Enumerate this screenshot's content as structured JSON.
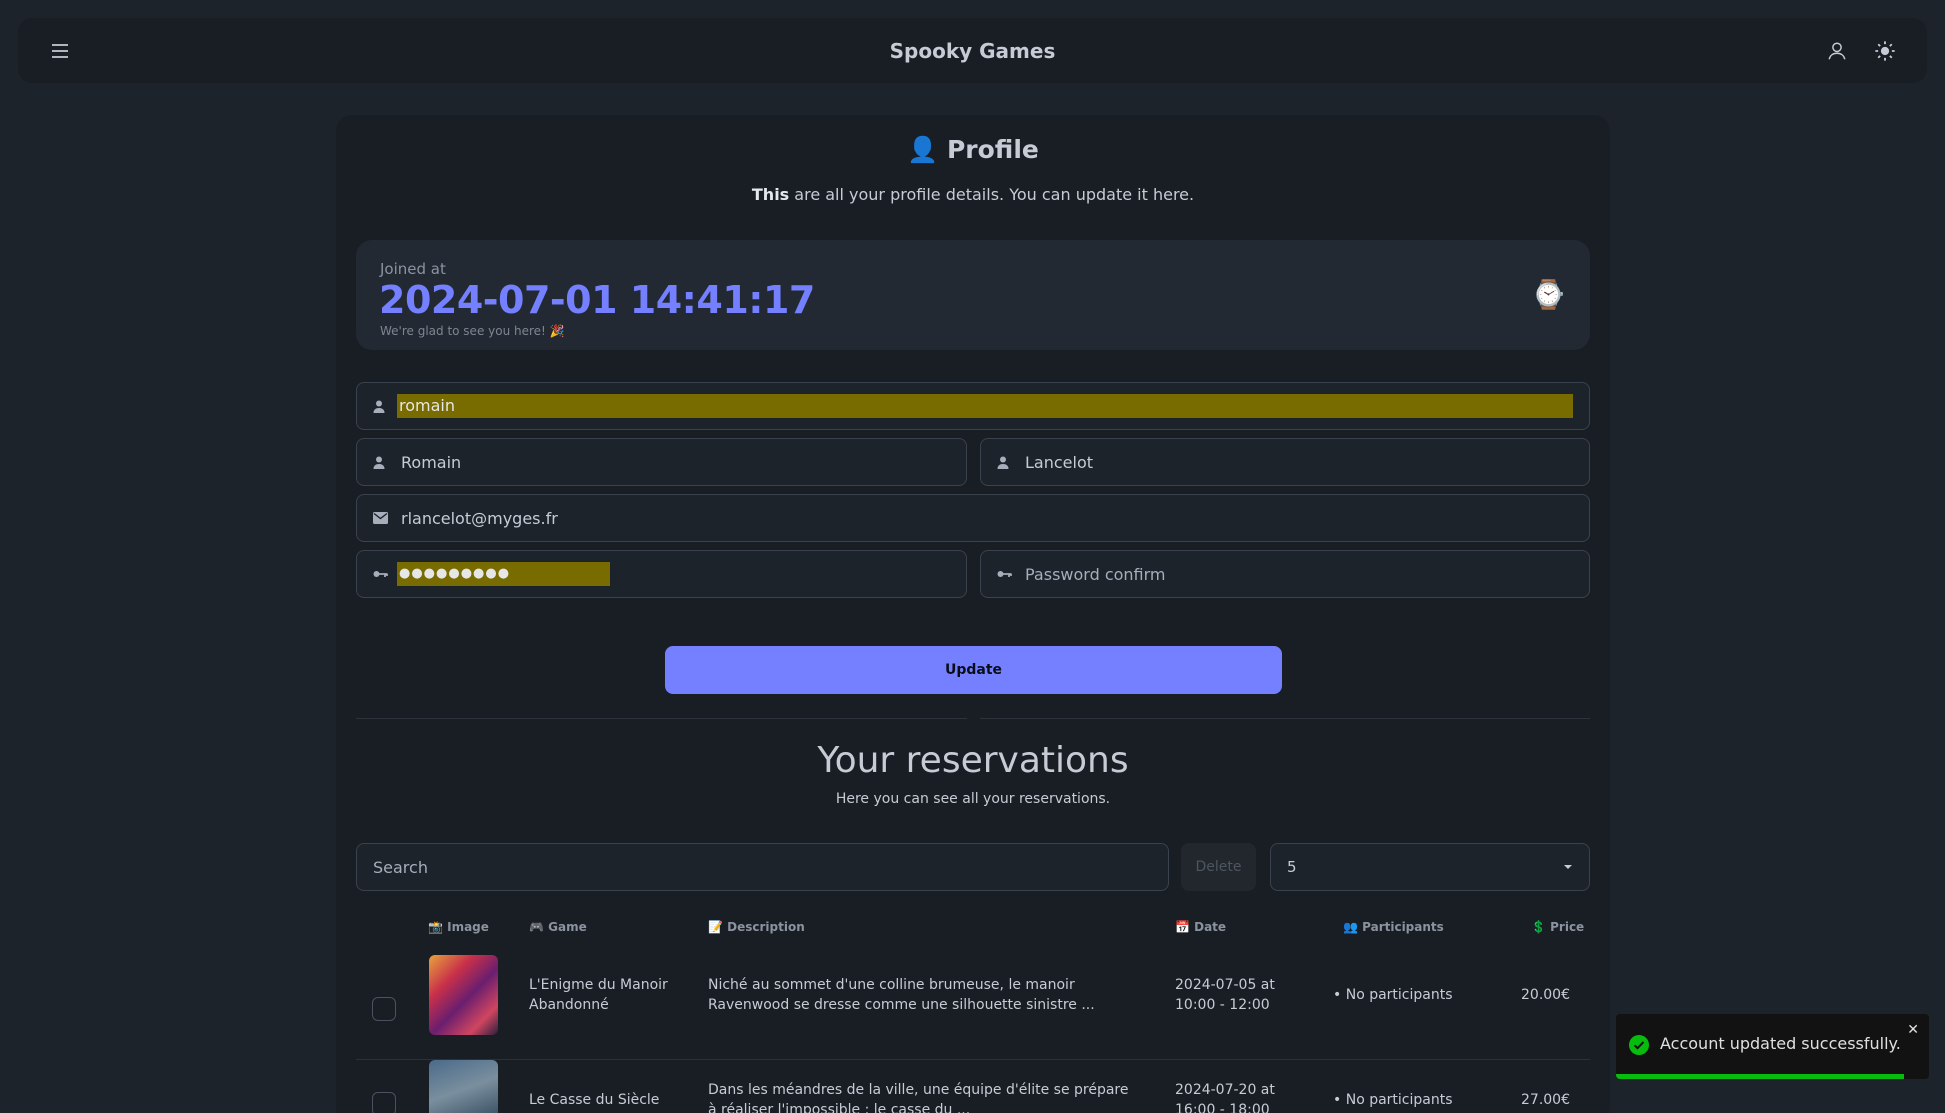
{
  "navbar": {
    "title": "Spooky Games",
    "menu_icon": "hamburger-icon",
    "user_icon": "user-icon",
    "theme_icon": "sun-icon"
  },
  "profile": {
    "title": "Profile",
    "title_icon": "👤",
    "subtitle_bold": "This",
    "subtitle_rest": " are all your profile details. You can update it here.",
    "joined": {
      "label": "Joined at",
      "value": "2024-07-01 14:41:17",
      "desc": "We're glad to see you here! 🎉",
      "icon": "⌚"
    },
    "fields": {
      "username": {
        "value": "romain",
        "icon": "user-icon"
      },
      "firstname": {
        "value": "Romain",
        "icon": "user-icon"
      },
      "lastname": {
        "value": "Lancelot",
        "icon": "user-icon"
      },
      "email": {
        "value": "rlancelot@myges.fr",
        "icon": "mail-icon"
      },
      "password": {
        "value": "●●●●●●●●●",
        "icon": "key-icon"
      },
      "password_confirm": {
        "placeholder": "Password confirm",
        "icon": "key-icon"
      }
    },
    "update_label": "Update"
  },
  "reservations": {
    "title": "Your reservations",
    "subtitle": "Here you can see all your reservations.",
    "search_placeholder": "Search",
    "delete_label": "Delete",
    "per_page": "5",
    "columns": {
      "image": "📸 Image",
      "game": "🎮 Game",
      "description": "📝 Description",
      "date": "📅 Date",
      "participants": "👥 Participants",
      "price": "💲 Price"
    },
    "rows": [
      {
        "game": "L'Enigme du Manoir Abandonné",
        "description": "Niché au sommet d'une colline brumeuse, le manoir Ravenwood se dresse comme une silhouette sinistre ...",
        "date": "2024-07-05 at 10:00 - 12:00",
        "participants": "No participants",
        "price": "20.00€"
      },
      {
        "game": "Le Casse du Siècle",
        "description": "Dans les méandres de la ville, une équipe d'élite se prépare à réaliser l'impossible : le casse du ...",
        "date": "2024-07-20 at 16:00 - 18:00",
        "participants": "No participants",
        "price": "27.00€"
      }
    ]
  },
  "toast": {
    "message": "Account updated successfully.",
    "close": "✕",
    "progress": 0.92,
    "color": "#07bc0c"
  },
  "colors": {
    "accent": "#7480ff",
    "background": "#1d232a",
    "card": "#191e24"
  }
}
